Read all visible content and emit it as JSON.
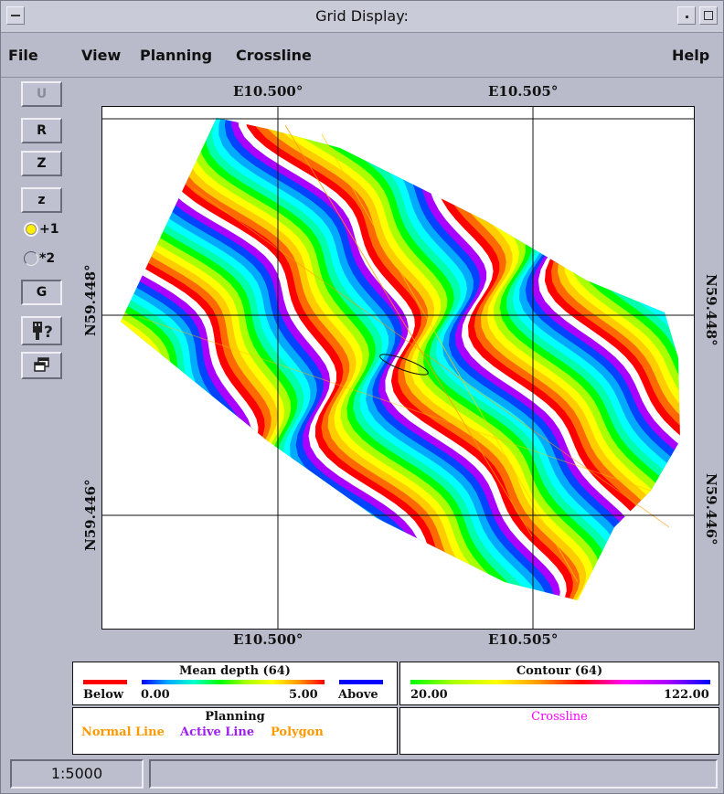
{
  "window": {
    "title": "Grid Display:"
  },
  "menubar": {
    "file": "File",
    "view": "View",
    "planning": "Planning",
    "crossline": "Crossline",
    "help": "Help"
  },
  "toolbar": {
    "u_label": "U",
    "r_label": "R",
    "Z_label": "Z",
    "z_label": "z",
    "radio1_label": "+1",
    "radio2_label": "*2",
    "g_label": "G"
  },
  "map": {
    "top_left_lon": "E10.500°",
    "top_right_lon": "E10.505°",
    "bottom_left_lon": "E10.500°",
    "bottom_right_lon": "E10.505°",
    "left_upper_lat": "N59.448°",
    "left_lower_lat": "N59.446°",
    "right_upper_lat": "N59.448°",
    "right_lower_lat": "N59.446°"
  },
  "legend": {
    "depth": {
      "title": "Mean depth (64)",
      "below": "Below",
      "min": "0.00",
      "max": "5.00",
      "above": "Above",
      "below_color": "#ff0000",
      "above_color": "#0000ff"
    },
    "contour": {
      "title": "Contour (64)",
      "min": "20.00",
      "max": "122.00"
    },
    "planning": {
      "title": "Planning",
      "normal": "Normal Line",
      "active": "Active Line",
      "polygon": "Polygon",
      "normal_color": "#ff9900",
      "active_color": "#a020f0",
      "polygon_color": "#ff9900"
    },
    "crossline": {
      "title": "Crossline",
      "color": "#ff00ff"
    }
  },
  "status": {
    "scale": "1:5000"
  }
}
